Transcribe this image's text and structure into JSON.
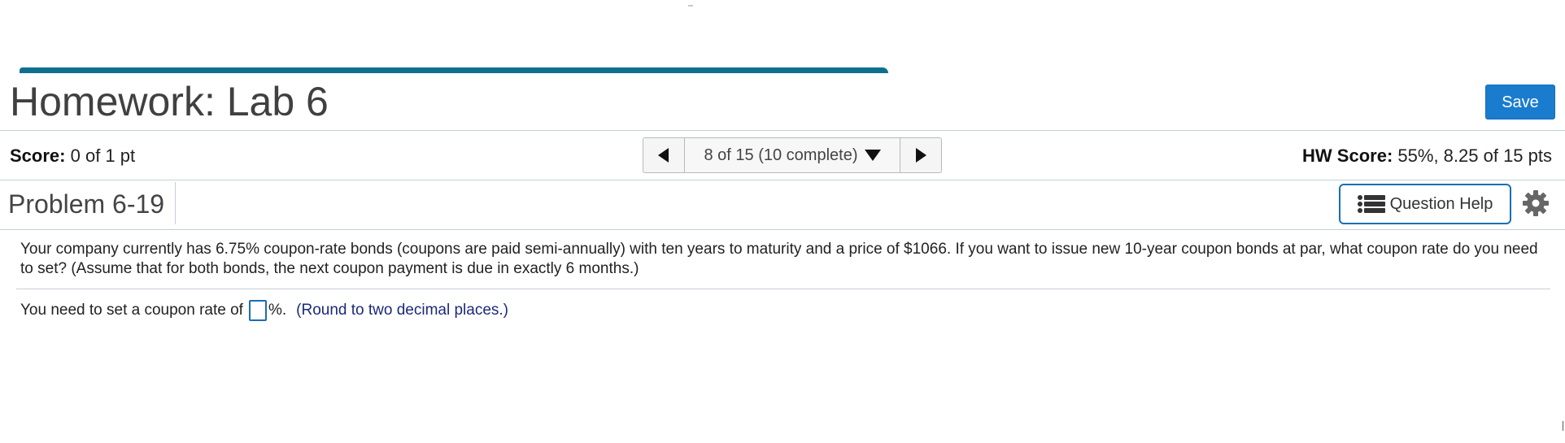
{
  "header": {
    "title": "Homework: Lab 6",
    "save_label": "Save",
    "accent_color": "#0f6f8f"
  },
  "score_bar": {
    "score_label": "Score:",
    "score_value": "0 of 1 pt",
    "question_selector": "8 of 15 (10 complete)",
    "hw_score_label": "HW Score:",
    "hw_score_value": "55%, 8.25 of 15 pts"
  },
  "problem": {
    "title": "Problem 6-19",
    "help_label": "Question Help",
    "icons": [
      "previous-arrow-icon",
      "dropdown-caret-icon",
      "next-arrow-icon",
      "list-icon",
      "gear-icon"
    ]
  },
  "question": {
    "text": "Your company currently has 6.75% coupon-rate bonds (coupons are paid semi-annually) with ten years to maturity and a price of $1066. If you want to issue new 10-year coupon bonds at par, what coupon rate do you need to set? (Assume that for both bonds, the next coupon payment is due in exactly 6 months.)",
    "answer_prefix": "You need to set a coupon rate of",
    "answer_value": "",
    "answer_suffix": "%.",
    "hint": "(Round to two decimal places.)"
  },
  "colors": {
    "save_button": "#1a7ccf",
    "focus_border": "#1a6eb5",
    "hint_text": "#1b2a7a"
  }
}
